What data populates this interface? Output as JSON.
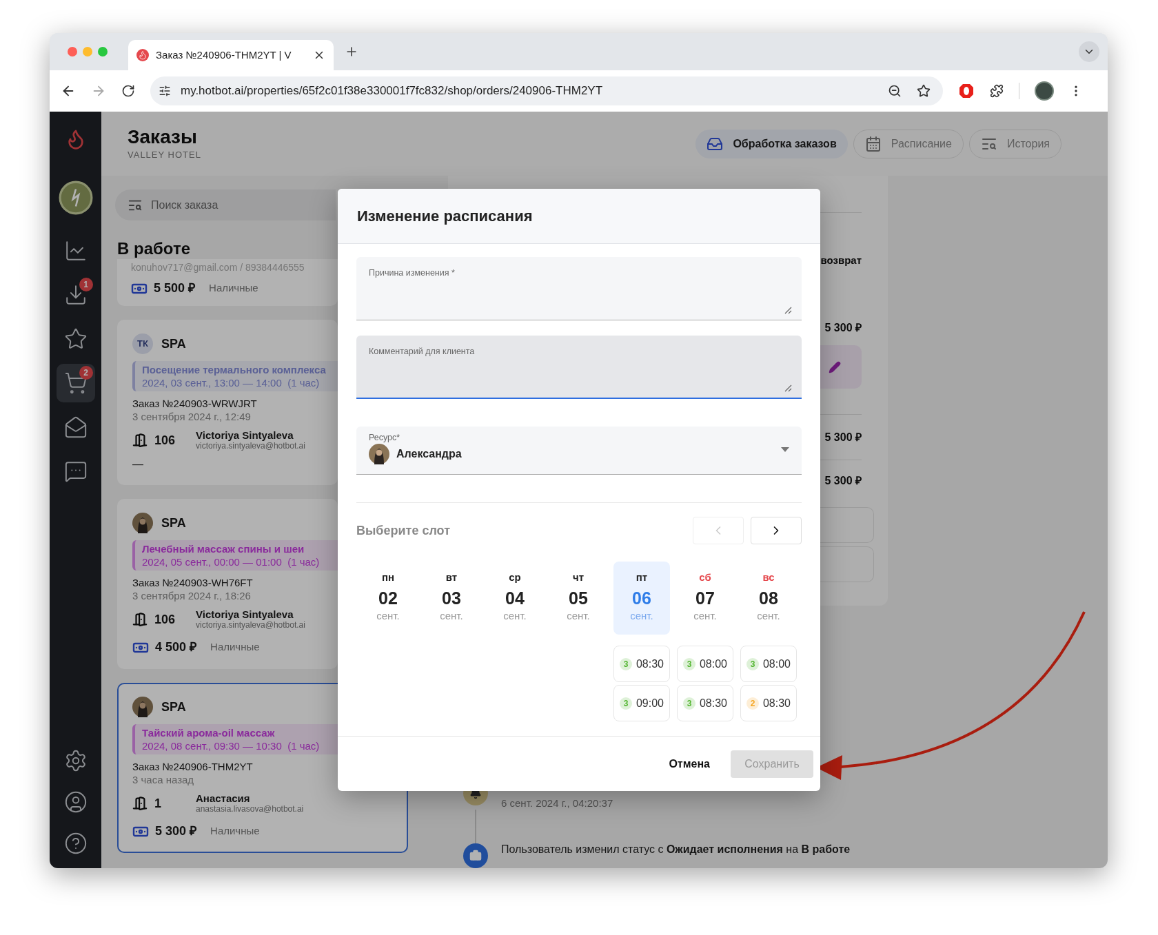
{
  "browser": {
    "tab_title": "Заказ №240906-THM2YT | V",
    "url": "my.hotbot.ai/properties/65f2c01f38e330001f7fc832/shop/orders/240906-THM2YT"
  },
  "sidebar": {
    "items": [
      {
        "kind": "chart",
        "selected": false
      },
      {
        "kind": "download",
        "badge": "1",
        "selected": false
      },
      {
        "kind": "rating",
        "selected": false
      },
      {
        "kind": "cart",
        "badge": "2",
        "selected": true
      },
      {
        "kind": "mail",
        "selected": false
      },
      {
        "kind": "chat",
        "selected": false
      }
    ],
    "bottom_items": [
      {
        "kind": "settings"
      },
      {
        "kind": "profile"
      },
      {
        "kind": "help"
      }
    ]
  },
  "header": {
    "title": "Заказы",
    "subtitle": "VALLEY HOTEL",
    "tabs": [
      {
        "kind": "inbox",
        "label": "Обработка заказов",
        "selected": true
      },
      {
        "kind": "calendar",
        "label": "Расписание",
        "selected": false
      },
      {
        "kind": "history",
        "label": "История",
        "selected": false
      }
    ]
  },
  "search": {
    "placeholder": "Поиск заказа"
  },
  "section_title": "В работе",
  "scrolled_card": {
    "contact": "konuhov717@gmail.com / 89384446555",
    "amount": "5 500 ₽",
    "payment": "Наличные"
  },
  "orders": [
    {
      "kind": "initials",
      "initials": "ТК",
      "category": "SPA",
      "service": "Посещение термального комплекса",
      "time": "2024, 03 сент., 13:00 — 14:00  (1 час)",
      "color": "#5a6096",
      "order": "Заказ №240903-WRWJRT",
      "created": "3 сентября 2024 г., 12:49",
      "room": "106",
      "guest": "Victoriya Sintyaleva",
      "email": "victoriya.sintyaleva@hotbot.ai",
      "dash": "—",
      "selected": false
    },
    {
      "kind": "photo",
      "category": "SPA",
      "service": "Лечебный массаж спины и шеи",
      "time": "2024, 05 сент., 00:00 — 01:00  (1 час)",
      "color": "#8a2a9c",
      "order": "Заказ №240903-WH76FT",
      "created": "3 сентября 2024 г., 18:26",
      "room": "106",
      "guest": "Victoriya Sintyaleva",
      "email": "victoriya.sintyaleva@hotbot.ai",
      "amount": "4 500 ₽",
      "payment": "Наличные",
      "selected": false
    },
    {
      "kind": "photo",
      "category": "SPA",
      "service": "Тайский арома-oil массаж",
      "time": "2024, 08 сент., 09:30 — 10:30  (1 час)",
      "color": "#8a2a9c",
      "order": "Заказ №240906-THM2YT",
      "created": "3 часа назад",
      "room": "1",
      "guest": "Анастасия",
      "email": "anastasia.livasova@hotbot.ai",
      "amount": "5 300 ₽",
      "payment": "Наличные",
      "selected": true
    }
  ],
  "details": {
    "refund_label": "возврат",
    "totals": [
      "5 300 ₽",
      "5 300 ₽",
      "5 300 ₽"
    ]
  },
  "timeline": [
    {
      "kind": "notification",
      "time": "6 сент. 2024 г., 04:20:37"
    },
    {
      "kind": "status",
      "text": "Пользователь изменил статус с **Ожидает исполнения** на **В работе**"
    }
  ],
  "modal": {
    "title": "Изменение расписания",
    "fields": [
      {
        "label": "Причина изменения *",
        "focused": false
      },
      {
        "label": "Комментарий для клиента",
        "focused": true
      }
    ],
    "resource": {
      "label": "Ресурс*",
      "value": "Александра"
    },
    "slot_title": "Выберите слот",
    "prev_disabled": true,
    "next_disabled": false,
    "days": [
      {
        "weekday": "пн",
        "day": "02",
        "month": "сент.",
        "weekend": false,
        "selected": false
      },
      {
        "weekday": "вт",
        "day": "03",
        "month": "сент.",
        "weekend": false,
        "selected": false
      },
      {
        "weekday": "ср",
        "day": "04",
        "month": "сент.",
        "weekend": false,
        "selected": false
      },
      {
        "weekday": "чт",
        "day": "05",
        "month": "сент.",
        "weekend": false,
        "selected": false
      },
      {
        "weekday": "пт",
        "day": "06",
        "month": "сент.",
        "weekend": false,
        "selected": true,
        "slots": [
          {
            "count": "3",
            "time": "08:30",
            "color": "#52b52f"
          },
          {
            "count": "3",
            "time": "09:00",
            "color": "#52b52f"
          }
        ]
      },
      {
        "weekday": "сб",
        "day": "07",
        "month": "сент.",
        "weekend": true,
        "selected": false,
        "slots": [
          {
            "count": "3",
            "time": "08:00",
            "color": "#52b52f"
          },
          {
            "count": "3",
            "time": "08:30",
            "color": "#52b52f"
          }
        ]
      },
      {
        "weekday": "вс",
        "day": "08",
        "month": "сент.",
        "weekend": true,
        "selected": false,
        "slots": [
          {
            "count": "3",
            "time": "08:00",
            "color": "#52b52f"
          },
          {
            "count": "2",
            "time": "08:30",
            "color": "#f5a623"
          }
        ]
      }
    ],
    "cancel": "Отмена",
    "save": "Сохранить",
    "save_disabled": true
  }
}
